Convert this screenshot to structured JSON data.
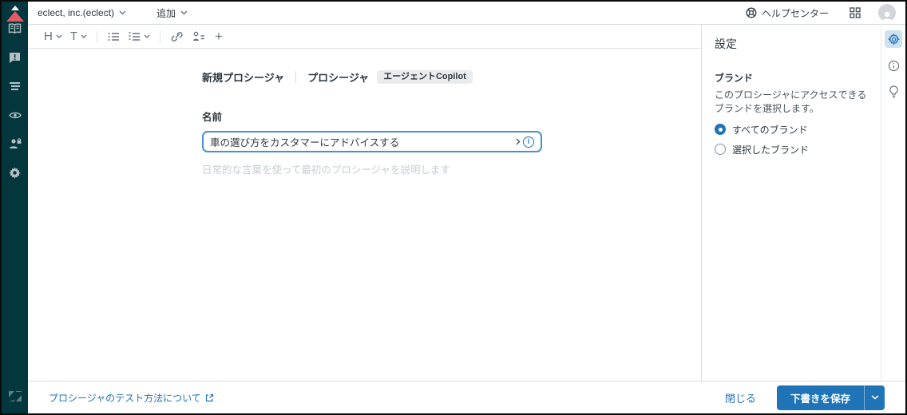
{
  "topbar": {
    "account_label": "eclect, inc.(eclect)",
    "add_label": "追加",
    "help_center_label": "ヘルプセンター"
  },
  "sidebar": {
    "items": [
      {
        "icon": "logo-mountain-icon"
      },
      {
        "icon": "knowledge-book-icon"
      },
      {
        "icon": "feedback-bubble-icon"
      },
      {
        "icon": "queue-lines-icon"
      },
      {
        "icon": "eye-icon"
      },
      {
        "icon": "people-lock-icon"
      },
      {
        "icon": "gear-icon"
      },
      {
        "icon": "zendesk-logo-icon"
      }
    ]
  },
  "toolbar": {
    "heading_label": "H",
    "text_label": "T",
    "plus_label": "+"
  },
  "breadcrumb": {
    "title": "新規プロシージャ",
    "section": "プロシージャ",
    "badge": "エージェントCopilot"
  },
  "form": {
    "name_label": "名前",
    "name_value": "車の選び方をカスタマーにアドバイスする",
    "name_help": "日常的な言葉を使って最初のプロシージャを説明します",
    "adornment_info": "i"
  },
  "settings_panel": {
    "title": "設定",
    "brand": {
      "label": "ブランド",
      "description": "このプロシージャにアクセスできるブランドを選択します。",
      "options": [
        {
          "label": "すべてのブランド",
          "selected": true
        },
        {
          "label": "選択したブランド",
          "selected": false
        }
      ]
    }
  },
  "footer": {
    "help_link": "プロシージャのテスト方法について",
    "close_label": "閉じる",
    "save_label": "下書きを保存"
  },
  "colors": {
    "accent_blue": "#1f73b7",
    "sidebar_bg": "#03363d",
    "logo_red": "#e35b66",
    "rail_active_bg": "#cee2f2",
    "border": "#d8dcde",
    "badge_bg": "#e9ebed"
  }
}
